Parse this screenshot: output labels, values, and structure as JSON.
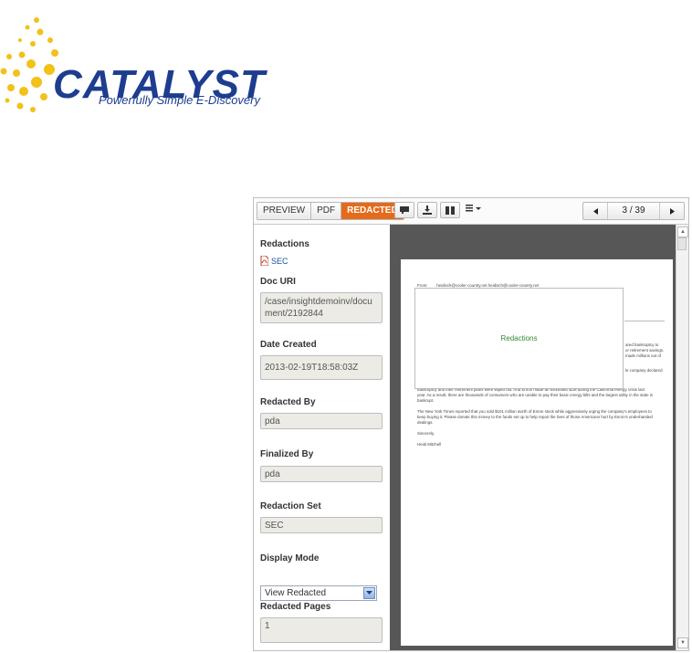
{
  "logo": {
    "name": "CATALYST",
    "tagline": "Powerfully Simple E-Discovery",
    "colors": {
      "brand_blue": "#1d3d8f",
      "sun_yellow": "#f2c11a"
    }
  },
  "toolbar": {
    "tabs": [
      {
        "label": "PREVIEW",
        "active": false
      },
      {
        "label": "PDF",
        "active": false
      },
      {
        "label": "REDACTED",
        "active": true
      }
    ],
    "accent_color": "#e46b1c",
    "icons": [
      "comment-icon",
      "download-icon",
      "columns-icon",
      "list-menu-icon"
    ],
    "pager": {
      "current": "3",
      "separator": "/",
      "total": "39"
    }
  },
  "sidebar": {
    "redactions": {
      "label": "Redactions",
      "link": "SEC"
    },
    "doc_uri": {
      "label": "Doc URI",
      "value": "/case/insightdemoinv/document/2192844"
    },
    "date_created": {
      "label": "Date Created",
      "value": "2013-02-19T18:58:03Z"
    },
    "redacted_by": {
      "label": "Redacted By",
      "value": "pda"
    },
    "finalized_by": {
      "label": "Finalized By",
      "value": "pda"
    },
    "redaction_set": {
      "label": "Redaction Set",
      "value": "SEC"
    },
    "display_mode": {
      "label": "Display Mode",
      "selected": "View Redacted"
    },
    "redacted_pages": {
      "label": "Redacted Pages",
      "value": "1"
    }
  },
  "document": {
    "from_label": "From:",
    "from_value": "heidisch@cooler-country.net heidisch@cooler-country.net",
    "redaction_label": "Redactions",
    "lines": [
      "ared bankruptcy to",
      "or retirement savings.",
      "made millions out of",
      "le company declared",
      "bankruptcy and their retirement plans were wiped out. And Enron made an estimated $1M during the California energy crisis last",
      "year. As a result, there are thousands of consumers who are unable to pay their basic energy bills and the largest utility in the state is",
      "bankrupt.",
      "The New York Times reported that you sold $101 million worth of Enron stock while aggressively urging the company's employees to",
      "keep buying it. Please donate this money to the funds set up to help repair the lives of those Americans hurt by Enron's underhanded",
      "dealings.",
      "Sincerely,",
      "Heidi Mitchell"
    ]
  }
}
